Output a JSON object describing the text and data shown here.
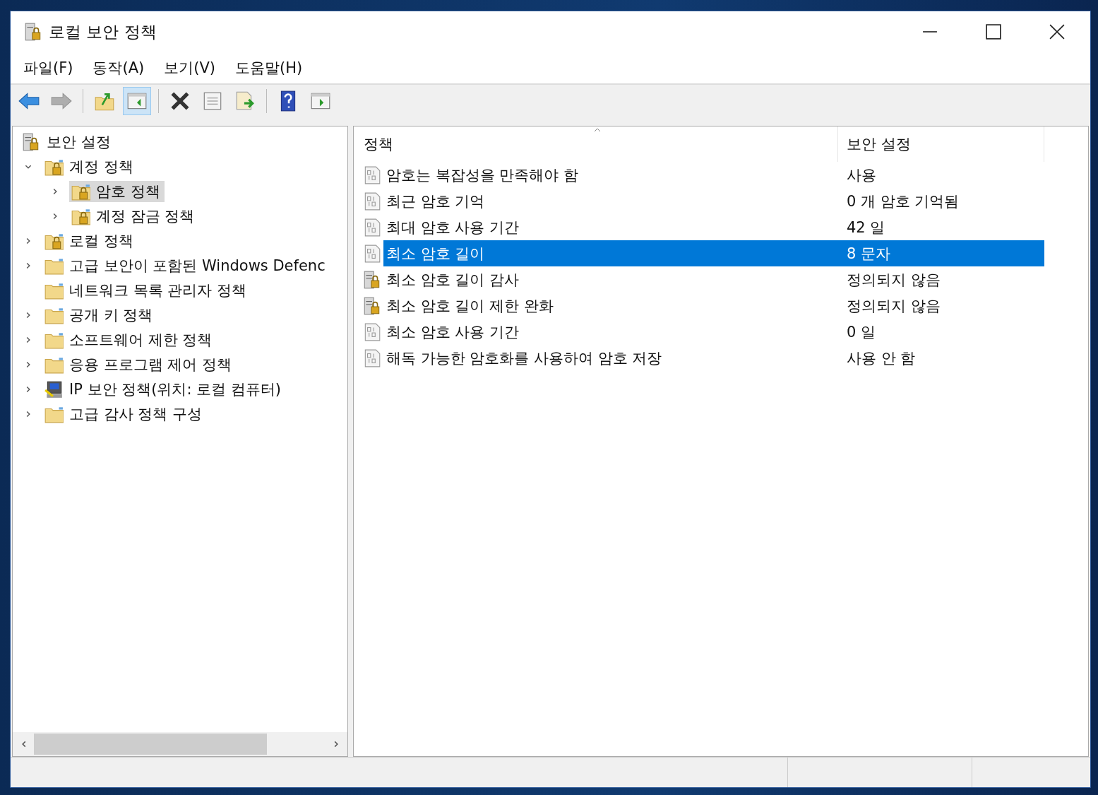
{
  "window": {
    "title": "로컬 보안 정책"
  },
  "menu": [
    "파일(F)",
    "동작(A)",
    "보기(V)",
    "도움말(H)"
  ],
  "toolbar": [
    [
      {
        "kind": "back",
        "disabled": false,
        "pressed": false
      },
      {
        "kind": "forward",
        "disabled": true,
        "pressed": false
      }
    ],
    [
      {
        "kind": "up",
        "disabled": false,
        "pressed": false
      },
      {
        "kind": "tree",
        "disabled": false,
        "pressed": true
      }
    ],
    [
      {
        "kind": "delete",
        "disabled": false,
        "pressed": false
      },
      {
        "kind": "properties",
        "disabled": false,
        "pressed": false
      },
      {
        "kind": "export",
        "disabled": false,
        "pressed": false
      }
    ],
    [
      {
        "kind": "help",
        "disabled": false,
        "pressed": false
      },
      {
        "kind": "action",
        "disabled": false,
        "pressed": false
      }
    ]
  ],
  "tree": [
    {
      "label": "보안 설정",
      "kind": "server",
      "selected": false,
      "children": [
        {
          "label": "계정 정책",
          "kind": "lock-folder",
          "expanded": true,
          "selected": false,
          "children": [
            {
              "label": "암호 정책",
              "kind": "lock-folder",
              "expanded": false,
              "selected": true
            },
            {
              "label": "계정 잠금 정책",
              "kind": "lock-folder",
              "expanded": false,
              "selected": false
            }
          ]
        },
        {
          "label": "로컬 정책",
          "kind": "lock-folder",
          "expanded": false,
          "selected": false
        },
        {
          "label": "고급 보안이 포함된 Windows Defenc",
          "kind": "folder",
          "expanded": false,
          "selected": false
        },
        {
          "label": "네트워크 목록 관리자 정책",
          "kind": "folder",
          "selected": false
        },
        {
          "label": "공개 키 정책",
          "kind": "folder",
          "expanded": false,
          "selected": false
        },
        {
          "label": "소프트웨어 제한 정책",
          "kind": "folder",
          "expanded": false,
          "selected": false
        },
        {
          "label": "응용 프로그램 제어 정책",
          "kind": "folder",
          "expanded": false,
          "selected": false
        },
        {
          "label": "IP 보안 정책(위치: 로컬 컴퓨터)",
          "kind": "ip",
          "expanded": false,
          "selected": false
        },
        {
          "label": "고급 감사 정책 구성",
          "kind": "folder",
          "expanded": false,
          "selected": false
        }
      ]
    }
  ],
  "table": {
    "columns": [
      "정책",
      "보안 설정"
    ],
    "rows": [
      {
        "kind": "binary",
        "policy": "암호는 복잡성을 만족해야 함",
        "setting": "사용",
        "selected": false
      },
      {
        "kind": "binary",
        "policy": "최근 암호 기억",
        "setting": "0 개 암호 기억됨",
        "selected": false
      },
      {
        "kind": "binary",
        "policy": "최대 암호 사용 기간",
        "setting": "42 일",
        "selected": false
      },
      {
        "kind": "binary",
        "policy": "최소 암호 길이",
        "setting": "8 문자",
        "selected": true
      },
      {
        "kind": "server",
        "policy": "최소 암호 길이 감사",
        "setting": "정의되지 않음",
        "selected": false
      },
      {
        "kind": "server",
        "policy": "최소 암호 길이 제한 완화",
        "setting": "정의되지 않음",
        "selected": false
      },
      {
        "kind": "binary",
        "policy": "최소 암호 사용 기간",
        "setting": "0 일",
        "selected": false
      },
      {
        "kind": "binary",
        "policy": "해독 가능한 암호화를 사용하여 암호 저장",
        "setting": "사용 안 함",
        "selected": false
      }
    ]
  }
}
